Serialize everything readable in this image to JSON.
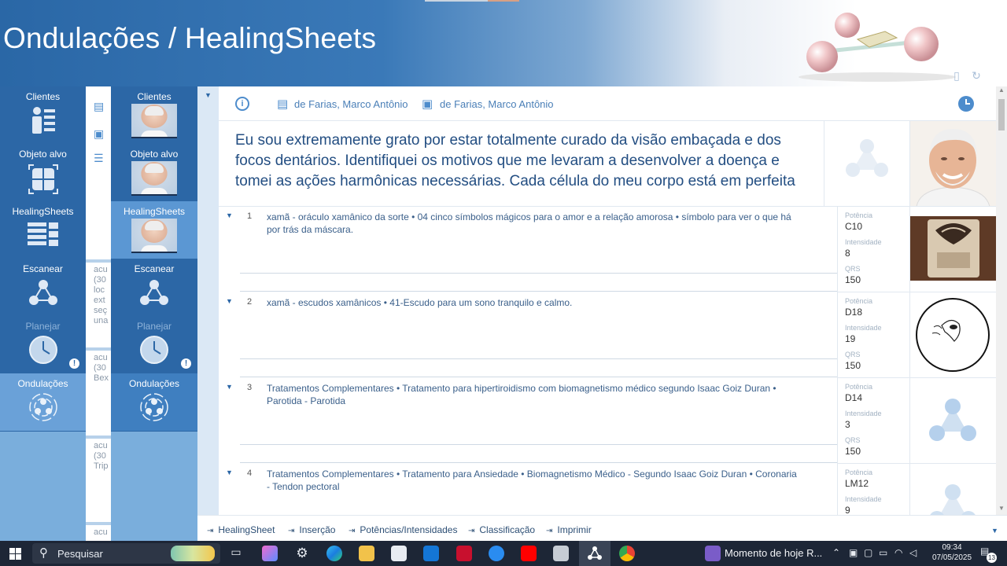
{
  "banner": {
    "title": "Ondulações / HealingSheets"
  },
  "nav1": {
    "items": [
      {
        "label": "Clientes"
      },
      {
        "label": "Objeto alvo"
      },
      {
        "label": "HealingSheets"
      },
      {
        "label": "Escanear"
      },
      {
        "label": "Planejar"
      },
      {
        "label": "Ondulações"
      }
    ]
  },
  "nav2": {
    "items": [
      {
        "label": "Clientes"
      },
      {
        "label": "Objeto alvo"
      },
      {
        "label": "HealingSheets"
      },
      {
        "label": "Escanear"
      },
      {
        "label": "Planejar"
      },
      {
        "label": "Ondulações"
      }
    ]
  },
  "panel_cards": [
    {
      "lines": [
        "acu",
        "(30",
        "loc",
        "ext",
        "seç",
        "una"
      ]
    },
    {
      "lines": [
        "acu",
        "(30",
        "Bex"
      ]
    },
    {
      "lines": [
        "acu",
        "(30",
        "Trip"
      ]
    },
    {
      "lines": [
        "acu"
      ]
    }
  ],
  "infobar": {
    "client_name": "de Farias, Marco Antônio",
    "target_name": "de Farias, Marco Antônio"
  },
  "affirmation": "Eu sou extremamente grato por estar totalmente curado da visão embaçada e dos focos dentários. Identifiquei os motivos que me levaram a desenvolver a doença e tomei as ações harmônicas necessárias. Cada célula do meu corpo está em perfeita",
  "labels": {
    "potencia": "Potência",
    "intensidade": "Intensidade",
    "qrs": "QRS"
  },
  "rows": [
    {
      "num": "1",
      "text": "xamã - oráculo xamânico da sorte • 04 cinco símbolos mágicos para o amor e a relação amorosa • símbolo para ver o que há por trás da máscara.",
      "potencia": "C10",
      "intensidade": "8",
      "qrs": "150"
    },
    {
      "num": "2",
      "text": "xamã - escudos xamânicos • 41-Escudo para um sono tranquilo e calmo.",
      "potencia": "D18",
      "intensidade": "19",
      "qrs": "150"
    },
    {
      "num": "3",
      "text": "Tratamentos Complementares • Tratamento para hipertiroidismo com biomagnetismo médico segundo Isaac Goiz Duran • Parotida - Parotida",
      "potencia": "D14",
      "intensidade": "3",
      "qrs": "150"
    },
    {
      "num": "4",
      "text": "Tratamentos Complementares • Tratamento para Ansiedade • Biomagnetismo Médico - Segundo Isaac Goiz Duran • Coronaria - Tendon pectoral",
      "potencia": "LM12",
      "intensidade": "9",
      "qrs": ""
    }
  ],
  "bottom_buttons": [
    {
      "label": "HealingSheet"
    },
    {
      "label": "Inserção"
    },
    {
      "label": "Potências/Intensidades"
    },
    {
      "label": "Classificação"
    },
    {
      "label": "Imprimir"
    }
  ],
  "taskbar": {
    "search_placeholder": "Pesquisar",
    "news": "Momento de hoje  R...",
    "time": "09:34",
    "date": "07/05/2025",
    "notifications": "13"
  },
  "colors": {
    "nav": "#2c67a6",
    "active": "#5b97d3",
    "accent": "#4d8ccc",
    "text": "#234e82"
  }
}
